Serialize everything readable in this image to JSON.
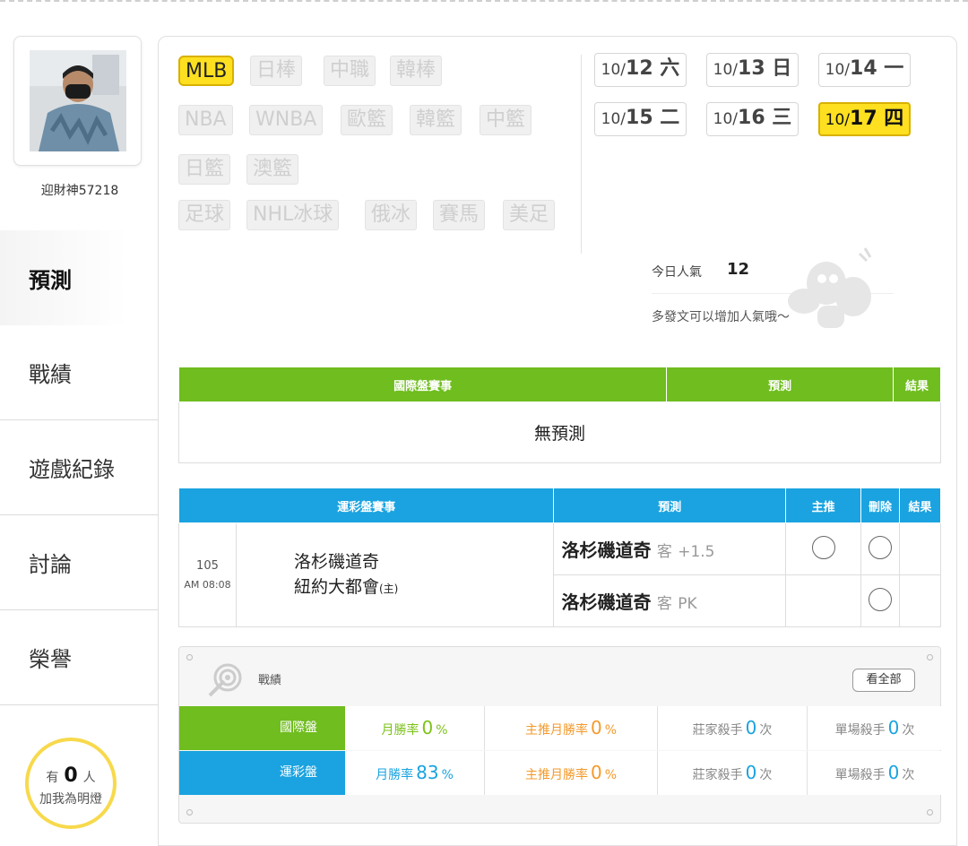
{
  "profile": {
    "username": "迎財神57218"
  },
  "nav": {
    "items": [
      "預測",
      "戰績",
      "遊戲紀錄",
      "討論",
      "榮譽"
    ],
    "active_index": 0
  },
  "fans": {
    "prefix": "有",
    "count": "0",
    "suffix": "人",
    "caption": "加我為明燈"
  },
  "leagues": [
    {
      "label": "MLB",
      "active": true
    },
    {
      "label": "日棒"
    },
    {
      "label": "中職"
    },
    {
      "label": "韓棒"
    },
    {
      "label": "NBA"
    },
    {
      "label": "WNBA"
    },
    {
      "label": "歐籃"
    },
    {
      "label": "韓籃"
    },
    {
      "label": "中籃"
    },
    {
      "label": "日籃"
    },
    {
      "label": "澳籃"
    },
    {
      "label": "足球"
    },
    {
      "label": "NHL冰球"
    },
    {
      "label": "俄冰"
    },
    {
      "label": "賽馬"
    },
    {
      "label": "美足"
    }
  ],
  "dates": [
    {
      "md": "10/",
      "day": "12 六"
    },
    {
      "md": "10/",
      "day": "13 日"
    },
    {
      "md": "10/",
      "day": "14 一"
    },
    {
      "md": "10/",
      "day": "15 二"
    },
    {
      "md": "10/",
      "day": "16 三"
    },
    {
      "md": "10/",
      "day": "17 四",
      "active": true
    }
  ],
  "popularity": {
    "label": "今日人氣",
    "count": "12",
    "hint": "多發文可以增加人氣哦～"
  },
  "intl_table": {
    "headers": [
      "國際盤賽事",
      "預測",
      "結果"
    ],
    "empty_text": "無預測"
  },
  "sports_table": {
    "headers": [
      "運彩盤賽事",
      "預測",
      "主推",
      "刪除",
      "結果"
    ],
    "game": {
      "number": "105",
      "time": "AM 08:08",
      "away": "洛杉磯道奇",
      "home": "紐約大都會",
      "home_mark": "(主)"
    },
    "predictions": [
      {
        "team": "洛杉磯道奇",
        "side": "客",
        "line": "+1.5"
      },
      {
        "team": "洛杉磯道奇",
        "side": "客",
        "line": "PK"
      }
    ]
  },
  "stats": {
    "title": "戰績",
    "see_all": "看全部",
    "rows": [
      {
        "category": "國際盤",
        "month_rate_label": "月勝率",
        "month_rate": "0",
        "month_rate_unit": "%",
        "top_rate_label": "主推月勝率",
        "top_rate": "0",
        "top_rate_unit": "%",
        "banker_label": "莊家殺手",
        "banker": "0",
        "banker_unit": "次",
        "single_label": "單場殺手",
        "single": "0",
        "single_unit": "次"
      },
      {
        "category": "運彩盤",
        "month_rate_label": "月勝率",
        "month_rate": "83",
        "month_rate_unit": "%",
        "top_rate_label": "主推月勝率",
        "top_rate": "0",
        "top_rate_unit": "%",
        "banker_label": "莊家殺手",
        "banker": "0",
        "banker_unit": "次",
        "single_label": "單場殺手",
        "single": "0",
        "single_unit": "次"
      }
    ]
  },
  "colors": {
    "accent_yellow": "#ffe020",
    "green": "#6fbd1e",
    "blue": "#1aa3e0",
    "orange": "#f39a2b",
    "stat_number_blue": "#1aa3e0"
  }
}
